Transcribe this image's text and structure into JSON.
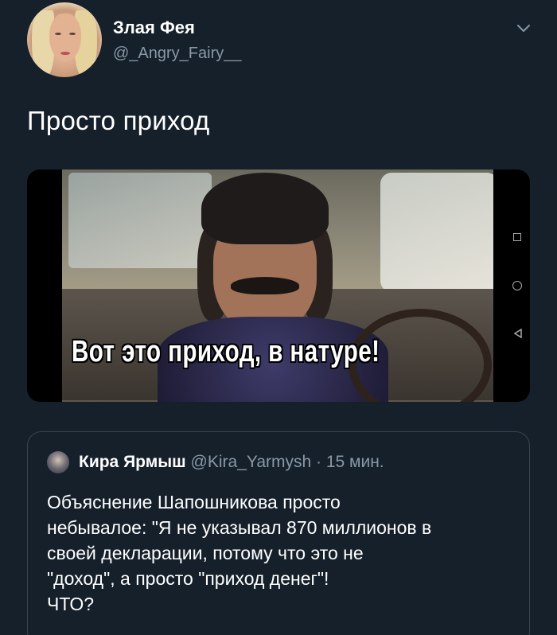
{
  "author": {
    "display_name": "Злая Фея",
    "handle": "@_Angry_Fairy__"
  },
  "tweet": {
    "text": "Просто приход"
  },
  "media": {
    "caption": "Вот это приход, в натуре!"
  },
  "quoted_tweet": {
    "display_name": "Кира Ярмыш",
    "handle": "@Kira_Yarmysh",
    "separator": " · ",
    "time": "15 мин.",
    "lines": [
      "Объяснение Шапошникова просто",
      "небывалое: \"Я не указывал 870 миллионов в",
      "своей декларации, потому что это не",
      "\"доход\", а просто \"приход денег\"!",
      "ЧТО?"
    ]
  },
  "icons": {
    "menu": "chevron-down-icon"
  },
  "colors": {
    "background": "#15202b",
    "secondary_text": "#8899a6",
    "border": "#38444d"
  }
}
